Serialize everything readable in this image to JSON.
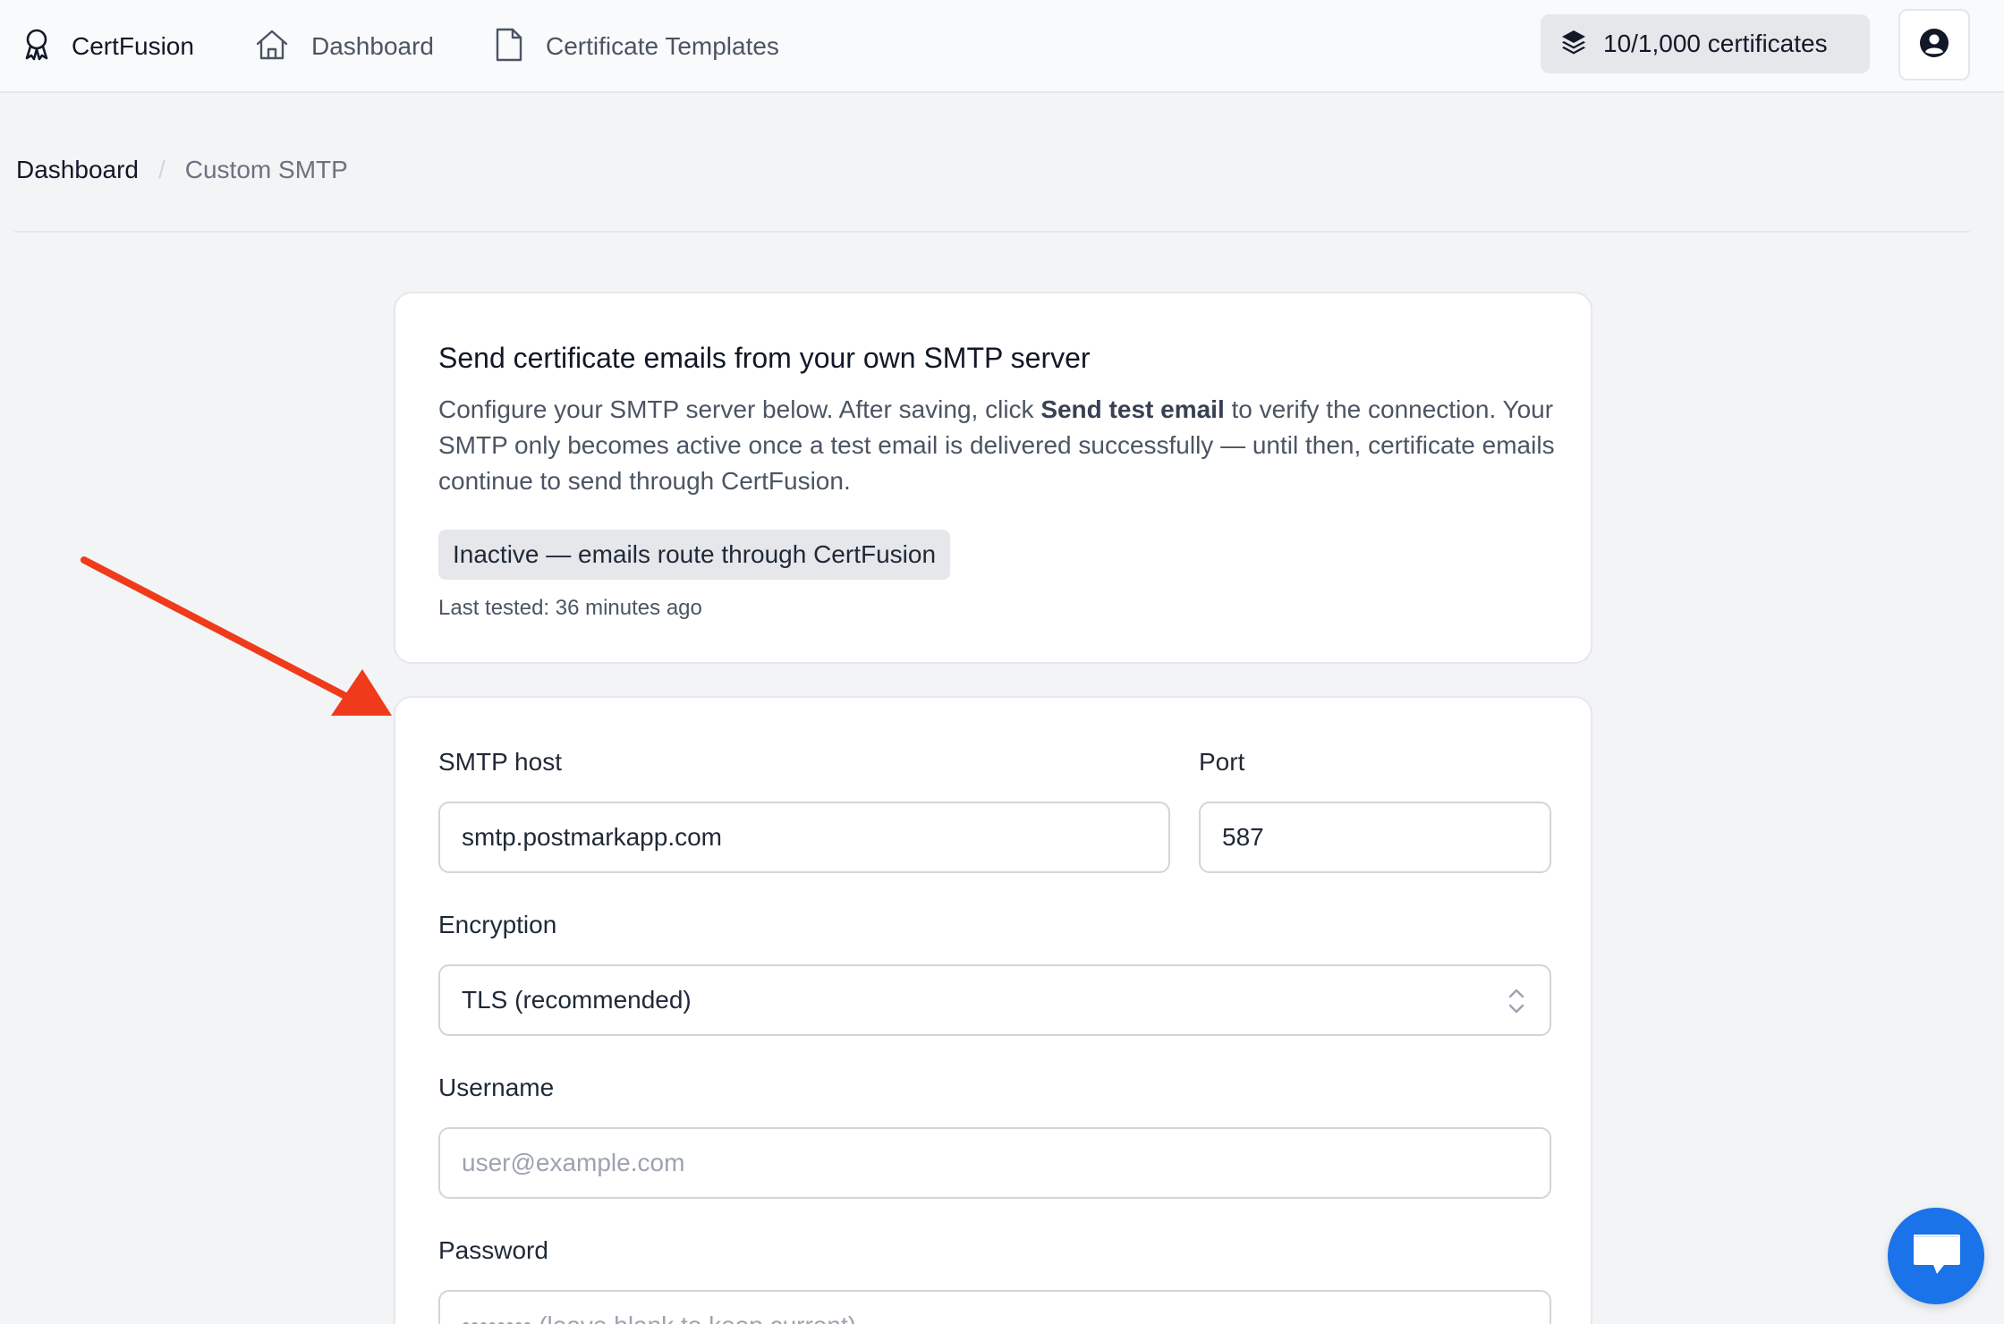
{
  "app": {
    "brand": "CertFusion",
    "nav": [
      {
        "label": "Dashboard",
        "icon": "home-icon"
      },
      {
        "label": "Certificate Templates",
        "icon": "document-icon"
      }
    ],
    "quota_label": "10/1,000 certificates",
    "quota_icon": "layers-icon",
    "account_icon": "user-circle-icon"
  },
  "breadcrumb": {
    "root": "Dashboard",
    "separator": "/",
    "current": "Custom SMTP"
  },
  "info_card": {
    "title": "Send certificate emails from your own SMTP server",
    "desc_before": "Configure your SMTP server below. After saving, click ",
    "desc_bold": "Send test email",
    "desc_after": " to verify the connection. Your SMTP only becomes active once a test email is delivered successfully — until then, certificate emails continue to send through CertFusion.",
    "status": "Inactive — emails route through CertFusion",
    "last_tested": "Last tested: 36 minutes ago"
  },
  "form": {
    "host_label": "SMTP host",
    "host_value": "smtp.postmarkapp.com",
    "port_label": "Port",
    "port_value": "587",
    "encryption_label": "Encryption",
    "encryption_value": "TLS (recommended)",
    "username_label": "Username",
    "username_placeholder": "user@example.com",
    "password_label": "Password",
    "password_placeholder": "•••••••• (leave blank to keep current)"
  },
  "colors": {
    "annotation_arrow": "#f03a1c",
    "chat_button": "#1a73e8"
  }
}
